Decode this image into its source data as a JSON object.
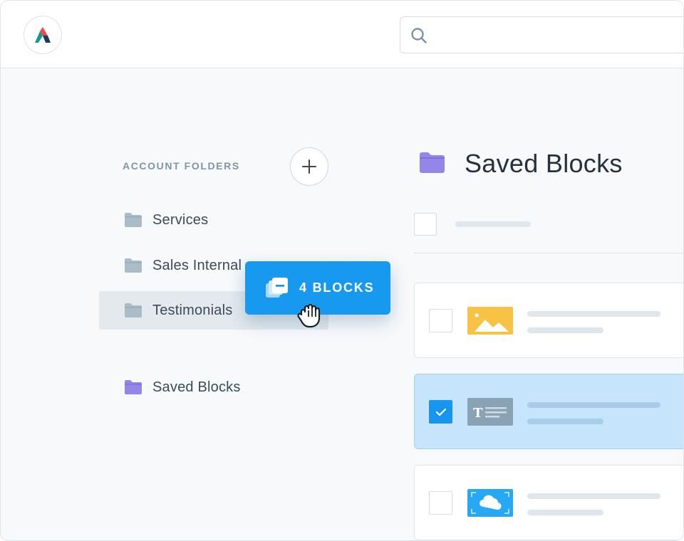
{
  "header": {
    "logo_name": "app-logo",
    "search": {
      "placeholder": "",
      "value": ""
    }
  },
  "sidebar": {
    "section_title": "ACCOUNT FOLDERS",
    "add_icon": "plus-icon",
    "folders": [
      {
        "label": "Services",
        "color": "#a9bcc8",
        "active": false
      },
      {
        "label": "Sales Internal",
        "color": "#a9bcc8",
        "active": false
      },
      {
        "label": "Testimonials",
        "color": "#a9bcc8",
        "active": true
      }
    ],
    "saved": {
      "label": "Saved Blocks",
      "color": "#9386e8"
    }
  },
  "drag": {
    "label": "4 BLOCKS",
    "icon": "stacked-blocks-icon",
    "cursor": "grab-hand-icon"
  },
  "main": {
    "title": "Saved Blocks",
    "title_icon_color": "#9386e8",
    "blocks": [
      {
        "type": "image",
        "thumb_icon": "image-icon",
        "thumb_color": "#f8c244",
        "checked": false
      },
      {
        "type": "text",
        "thumb_icon": "text-icon",
        "thumb_color": "#8aa3b4",
        "checked": true
      },
      {
        "type": "cloud",
        "thumb_icon": "cloud-icon",
        "thumb_color": "#27a8f4",
        "checked": false
      }
    ]
  },
  "colors": {
    "accent": "#1899f0",
    "selected_row": "#c6e4fb",
    "background": "#f7f9fb"
  }
}
